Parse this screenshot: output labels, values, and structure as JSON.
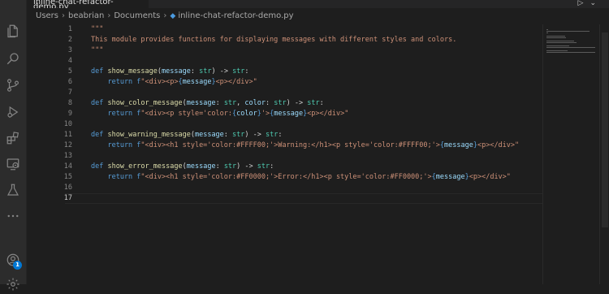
{
  "tab": {
    "title": "inline-chat-refactor-demo.py"
  },
  "breadcrumb": {
    "items": [
      "Users",
      "beabrian",
      "Documents"
    ],
    "file": "inline-chat-refactor-demo.py"
  },
  "activity_bar": {
    "icons": [
      "files-icon",
      "search-icon",
      "source-control-icon",
      "run-debug-icon",
      "extensions-icon",
      "remote-explorer-icon",
      "testing-icon",
      "more-icon",
      "accounts-icon",
      "settings-gear-icon"
    ],
    "accounts_badge": "1"
  },
  "editor": {
    "lines": [
      {
        "n": "1",
        "code": [
          {
            "t": "\"\"\"",
            "c": "st"
          }
        ]
      },
      {
        "n": "2",
        "code": [
          {
            "t": "This module provides functions for displaying messages with different styles and colors.",
            "c": "st"
          }
        ]
      },
      {
        "n": "3",
        "code": [
          {
            "t": "\"\"\"",
            "c": "st"
          }
        ]
      },
      {
        "n": "4",
        "code": []
      },
      {
        "n": "5",
        "code": [
          {
            "t": "def ",
            "c": "kw"
          },
          {
            "t": "show_message",
            "c": "fn"
          },
          {
            "t": "(",
            "c": ""
          },
          {
            "t": "message",
            "c": "pr"
          },
          {
            "t": ": ",
            "c": ""
          },
          {
            "t": "str",
            "c": "ty"
          },
          {
            "t": ") -> ",
            "c": ""
          },
          {
            "t": "str",
            "c": "ty"
          },
          {
            "t": ":",
            "c": ""
          }
        ]
      },
      {
        "n": "6",
        "code": [
          {
            "t": "    return ",
            "c": "kw"
          },
          {
            "t": "f",
            "c": "kw"
          },
          {
            "t": "\"<div><p>",
            "c": "st"
          },
          {
            "t": "{",
            "c": "kw"
          },
          {
            "t": "message",
            "c": "pr"
          },
          {
            "t": "}",
            "c": "kw"
          },
          {
            "t": "<p></div>\"",
            "c": "st"
          }
        ]
      },
      {
        "n": "7",
        "code": []
      },
      {
        "n": "8",
        "code": [
          {
            "t": "def ",
            "c": "kw"
          },
          {
            "t": "show_color_message",
            "c": "fn"
          },
          {
            "t": "(",
            "c": ""
          },
          {
            "t": "message",
            "c": "pr"
          },
          {
            "t": ": ",
            "c": ""
          },
          {
            "t": "str",
            "c": "ty"
          },
          {
            "t": ", ",
            "c": ""
          },
          {
            "t": "color",
            "c": "pr"
          },
          {
            "t": ": ",
            "c": ""
          },
          {
            "t": "str",
            "c": "ty"
          },
          {
            "t": ") -> ",
            "c": ""
          },
          {
            "t": "str",
            "c": "ty"
          },
          {
            "t": ":",
            "c": ""
          }
        ]
      },
      {
        "n": "9",
        "code": [
          {
            "t": "    return ",
            "c": "kw"
          },
          {
            "t": "f",
            "c": "kw"
          },
          {
            "t": "\"<div><p style='color:",
            "c": "st"
          },
          {
            "t": "{",
            "c": "kw"
          },
          {
            "t": "color",
            "c": "pr"
          },
          {
            "t": "}",
            "c": "kw"
          },
          {
            "t": "'>",
            "c": "st"
          },
          {
            "t": "{",
            "c": "kw"
          },
          {
            "t": "message",
            "c": "pr"
          },
          {
            "t": "}",
            "c": "kw"
          },
          {
            "t": "<p></div>\"",
            "c": "st"
          }
        ]
      },
      {
        "n": "10",
        "code": []
      },
      {
        "n": "11",
        "code": [
          {
            "t": "def ",
            "c": "kw"
          },
          {
            "t": "show_warning_message",
            "c": "fn"
          },
          {
            "t": "(",
            "c": ""
          },
          {
            "t": "message",
            "c": "pr"
          },
          {
            "t": ": ",
            "c": ""
          },
          {
            "t": "str",
            "c": "ty"
          },
          {
            "t": ") -> ",
            "c": ""
          },
          {
            "t": "str",
            "c": "ty"
          },
          {
            "t": ":",
            "c": ""
          }
        ]
      },
      {
        "n": "12",
        "code": [
          {
            "t": "    return ",
            "c": "kw"
          },
          {
            "t": "f",
            "c": "kw"
          },
          {
            "t": "\"<div><h1 style='color:#FFFF00;'>Warning:</h1><p style='color:#FFFF00;'>",
            "c": "st"
          },
          {
            "t": "{",
            "c": "kw"
          },
          {
            "t": "message",
            "c": "pr"
          },
          {
            "t": "}",
            "c": "kw"
          },
          {
            "t": "<p></div>\"",
            "c": "st"
          }
        ]
      },
      {
        "n": "13",
        "code": []
      },
      {
        "n": "14",
        "code": [
          {
            "t": "def ",
            "c": "kw"
          },
          {
            "t": "show_error_message",
            "c": "fn"
          },
          {
            "t": "(",
            "c": ""
          },
          {
            "t": "message",
            "c": "pr"
          },
          {
            "t": ": ",
            "c": ""
          },
          {
            "t": "str",
            "c": "ty"
          },
          {
            "t": ") -> ",
            "c": ""
          },
          {
            "t": "str",
            "c": "ty"
          },
          {
            "t": ":",
            "c": ""
          }
        ]
      },
      {
        "n": "15",
        "code": [
          {
            "t": "    return ",
            "c": "kw"
          },
          {
            "t": "f",
            "c": "kw"
          },
          {
            "t": "\"<div><h1 style='color:#FF0000;'>Error:</h1><p style='color:#FF0000;'>",
            "c": "st"
          },
          {
            "t": "{",
            "c": "kw"
          },
          {
            "t": "message",
            "c": "pr"
          },
          {
            "t": "}",
            "c": "kw"
          },
          {
            "t": "<p></div>\"",
            "c": "st"
          }
        ]
      },
      {
        "n": "16",
        "code": []
      },
      {
        "n": "17",
        "code": []
      }
    ],
    "current_line": "17"
  },
  "colors": {
    "keyword": "#569cd6",
    "function": "#dcdcaa",
    "parameter": "#9cdcfe",
    "type": "#4ec9b0",
    "string": "#ce9178",
    "background": "#1e1e1e"
  }
}
